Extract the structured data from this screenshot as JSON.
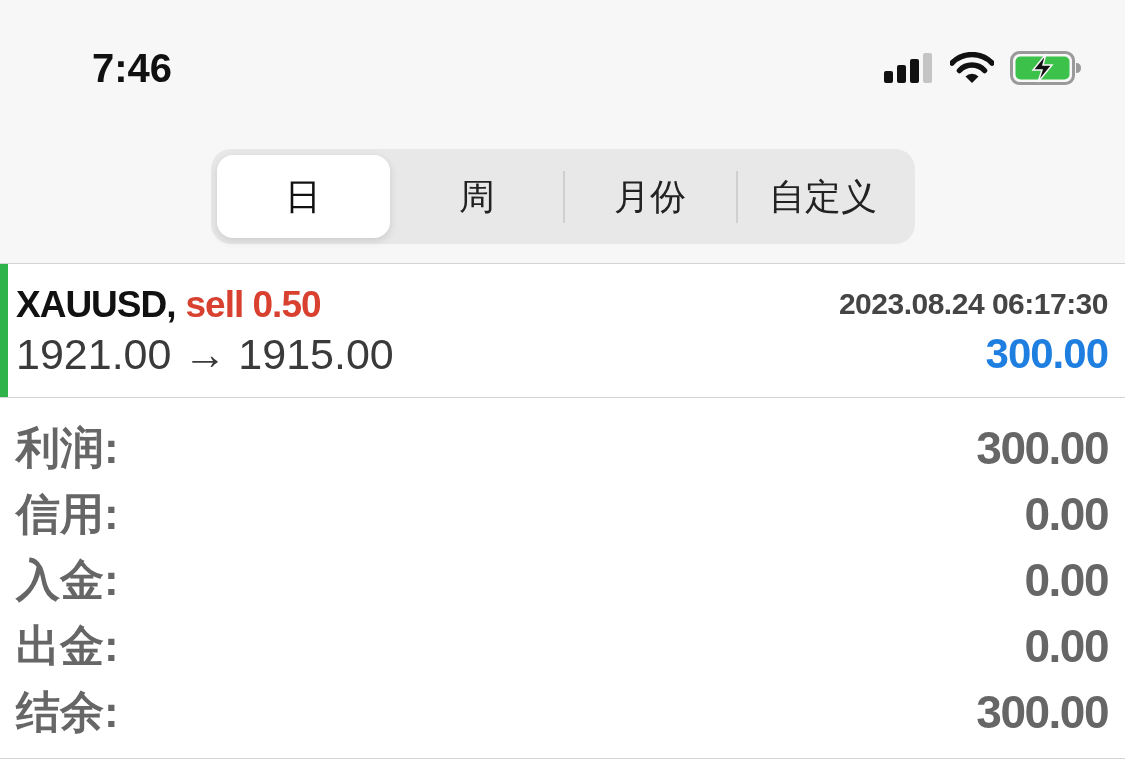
{
  "status_bar": {
    "time": "7:46"
  },
  "segments": [
    {
      "label": "日",
      "selected": true
    },
    {
      "label": "周",
      "selected": false
    },
    {
      "label": "月份",
      "selected": false
    },
    {
      "label": "自定义",
      "selected": false
    }
  ],
  "trades": [
    {
      "symbol": "XAUUSD,",
      "kind": "sell",
      "side": "sell 0.50",
      "time": "2023.08.24 06:17:30",
      "prices": "1921.00 → 1915.00",
      "profit": "300.00",
      "color": "#2db34a"
    }
  ],
  "summary": [
    {
      "label": "利润:",
      "value": "300.00"
    },
    {
      "label": "信用:",
      "value": "0.00"
    },
    {
      "label": "入金:",
      "value": "0.00"
    },
    {
      "label": "出金:",
      "value": "0.00"
    },
    {
      "label": "结余:",
      "value": "300.00"
    }
  ]
}
